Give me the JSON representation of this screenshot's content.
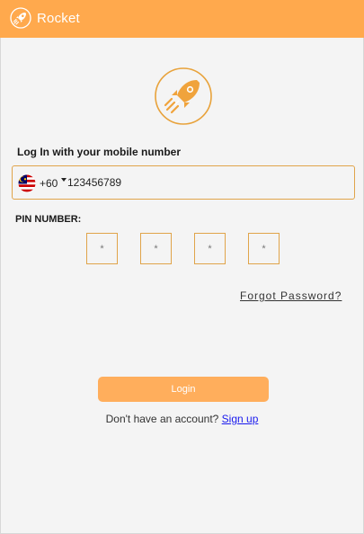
{
  "app": {
    "title": "Rocket",
    "brand_color": "#ffa94d",
    "logo_icon": "rocket-icon"
  },
  "login_form": {
    "mobile_label": "Log In with your mobile number",
    "country": {
      "flag_icon": "malaysia-flag-icon",
      "code": "+60"
    },
    "phone": {
      "value": "123456789"
    },
    "pin_label": "PIN NUMBER:",
    "pin_digits": [
      "*",
      "*",
      "*",
      "*"
    ],
    "forgot_password": "Forgot Password?",
    "login_button": "Login",
    "signup_prompt": "Don't have an account?",
    "signup_link": "Sign up"
  }
}
